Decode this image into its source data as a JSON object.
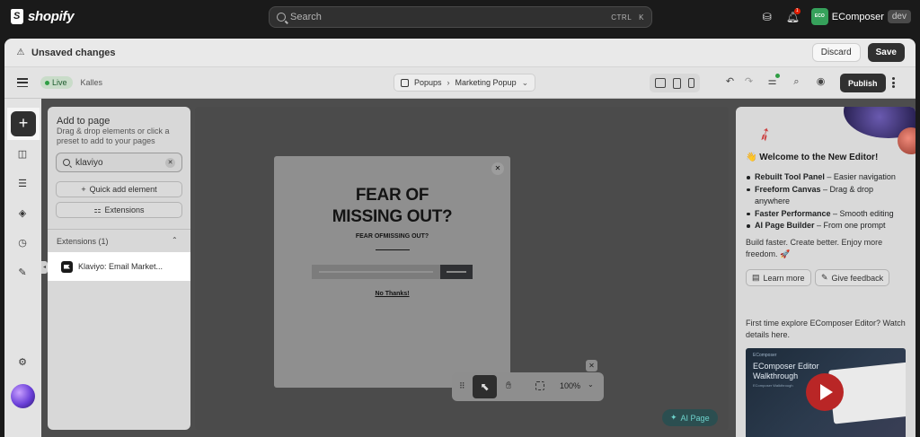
{
  "shopify": {
    "brand": "shopify",
    "search_placeholder": "Search",
    "shortcut_ctrl": "CTRL",
    "shortcut_key": "K",
    "notification_count": "1",
    "store_initials": "ECO",
    "store_name": "EComposer",
    "store_env": "dev"
  },
  "unsaved_bar": {
    "message": "Unsaved changes",
    "discard_label": "Discard",
    "save_label": "Save"
  },
  "toolbar": {
    "status": "Live",
    "theme": "Kalles",
    "breadcrumb": [
      "Popups",
      "Marketing Popup"
    ],
    "publish_label": "Publish"
  },
  "add_panel": {
    "title": "Add to page",
    "description": "Drag & drop elements or click a preset to add to your pages",
    "search_value": "klaviyo",
    "quick_add_label": "Quick add element",
    "extensions_btn_label": "Extensions",
    "extensions_header": "Extensions (1)",
    "extension_items": [
      {
        "label": "Klaviyo: Email Market..."
      }
    ]
  },
  "popup": {
    "headline_line1": "FEAR OF",
    "headline_line2": "MISSING OUT?",
    "subheadline": "FEAR OFMISSING OUT?",
    "no_thanks": "No Thanks!"
  },
  "floating_bar": {
    "zoom": "100%"
  },
  "ai_page_label": "AI Page",
  "side_panel": {
    "welcome": "👋 Welcome to the New Editor!",
    "features": [
      {
        "bold": "Rebuilt Tool Panel",
        "rest": " – Easier navigation"
      },
      {
        "bold": "Freeform Canvas",
        "rest": " – Drag & drop anywhere"
      },
      {
        "bold": "Faster Performance",
        "rest": " – Smooth editing"
      },
      {
        "bold": "AI Page Builder",
        "rest": " – From one prompt"
      }
    ],
    "tagline": "Build faster. Create better. Enjoy more freedom. 🚀",
    "learn_more_label": "Learn more",
    "feedback_label": "Give feedback",
    "first_time_text": "First time explore EComposer Editor? Watch details here.",
    "video": {
      "brand": "EComposer",
      "title": "EComposer Editor Walkthrough",
      "subtitle": "EComposer Walkthrough"
    }
  },
  "colors": {
    "accent_green": "#2f9e44",
    "ai_teal": "#6ed3cc",
    "dark_button": "#303030"
  }
}
